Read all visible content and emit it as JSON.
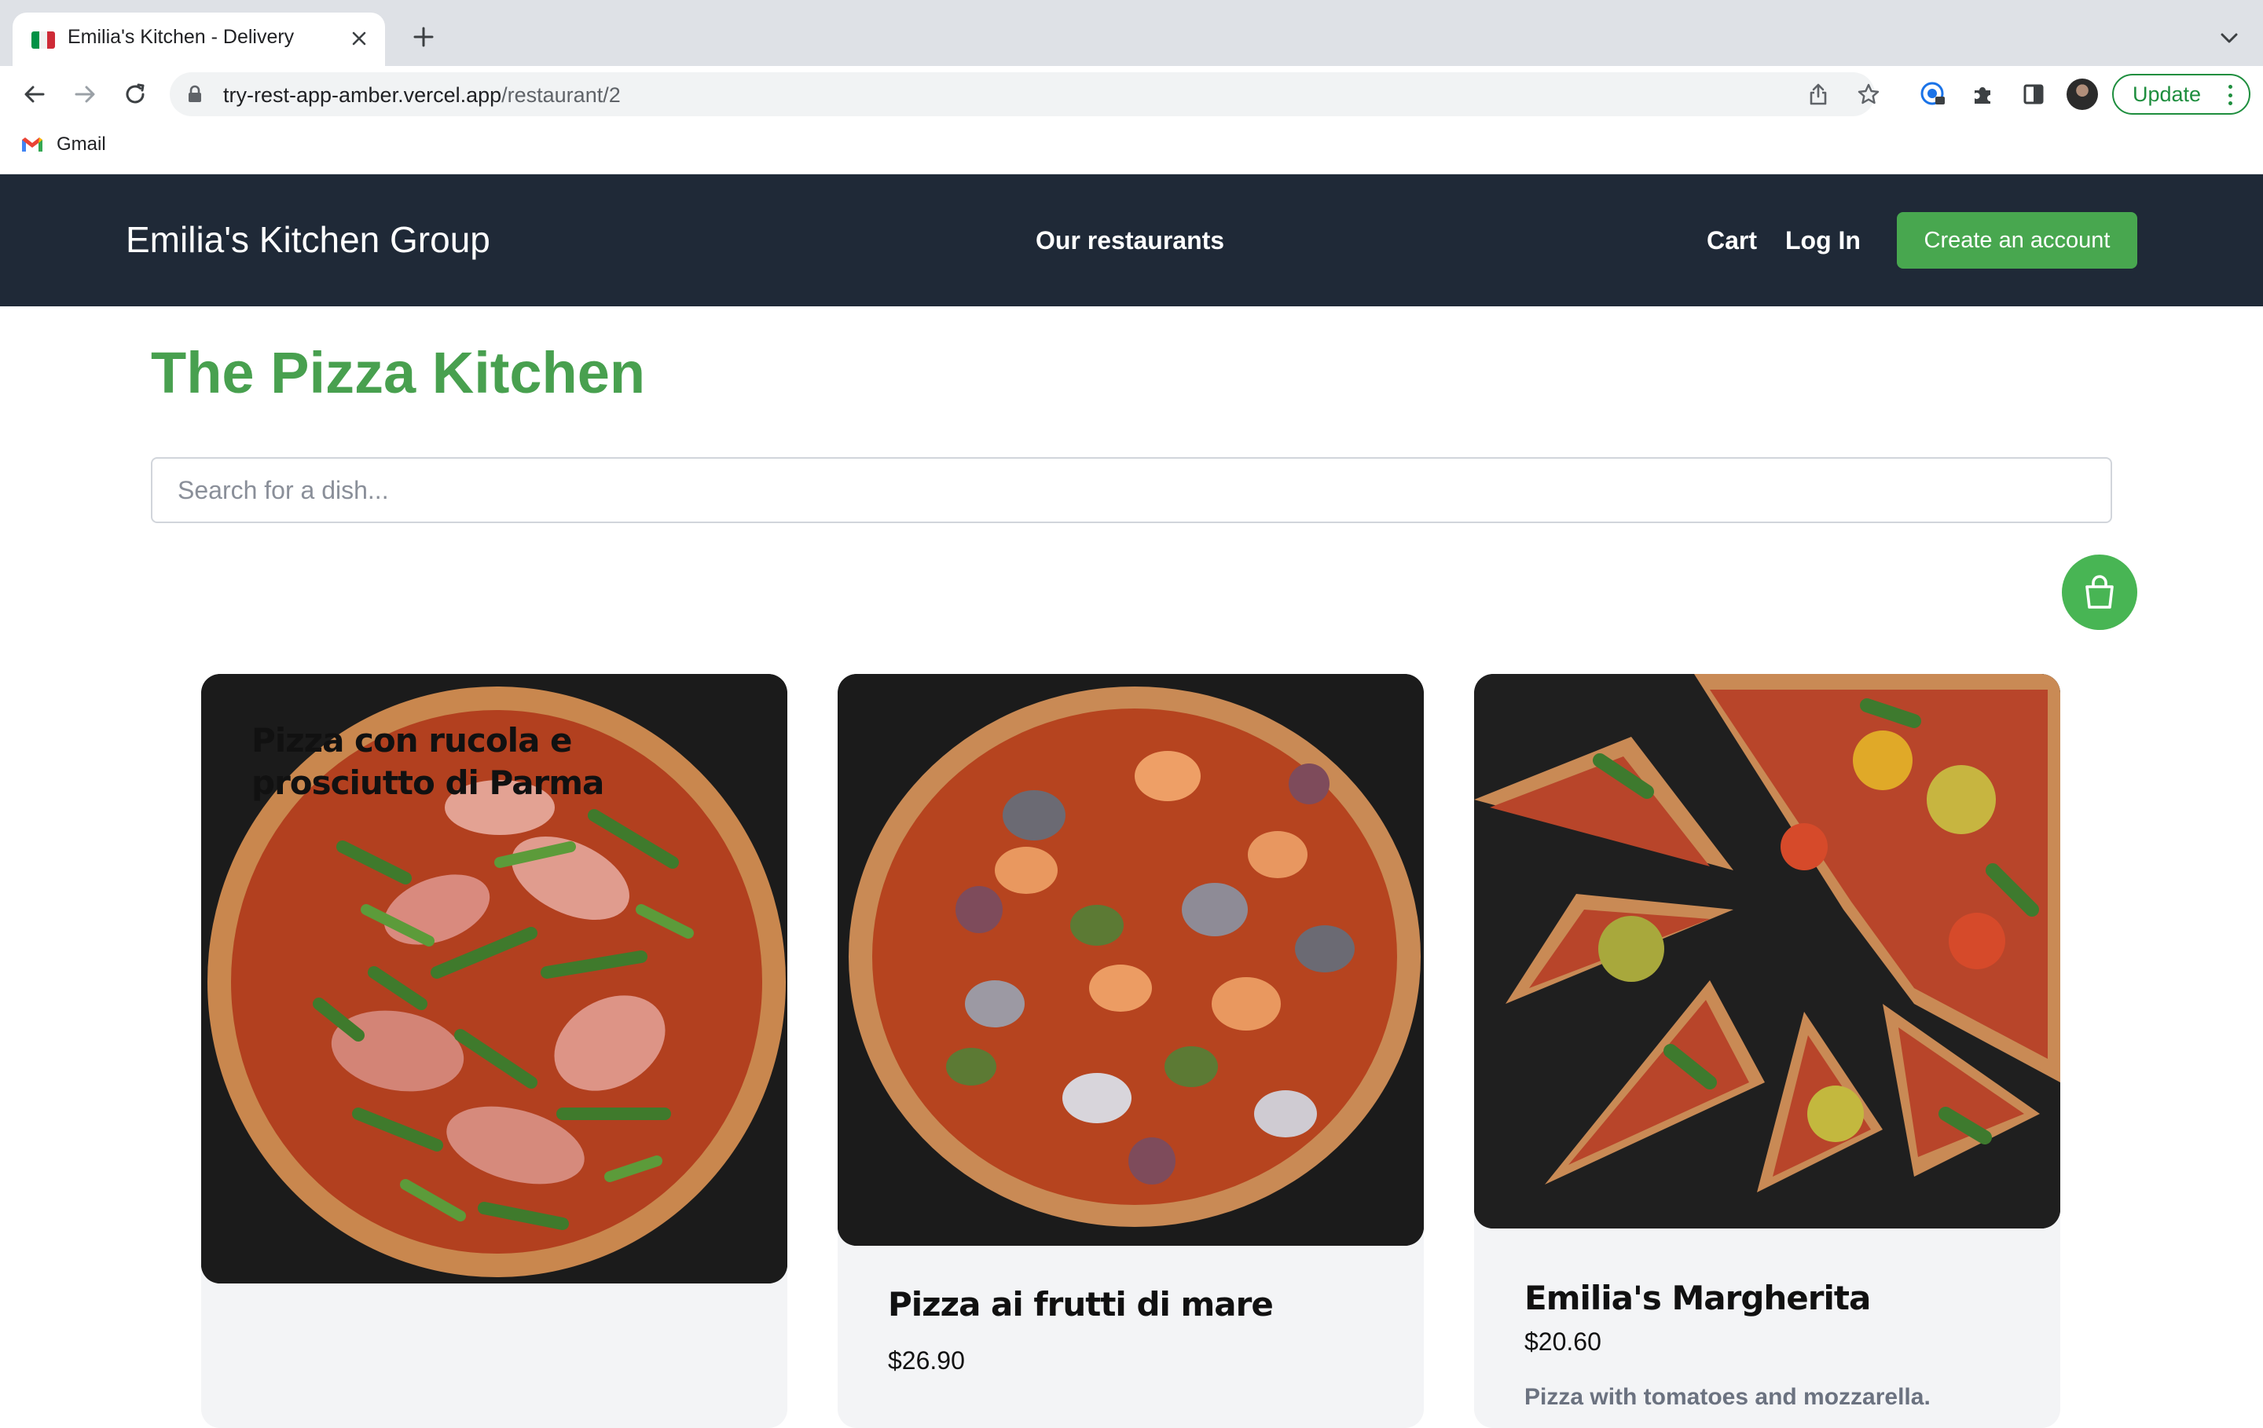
{
  "browser": {
    "tab_title": "Emilia's Kitchen - Delivery",
    "url_host": "try-rest-app-amber.vercel.app",
    "url_path": "/restaurant/2",
    "update_label": "Update",
    "bookmarks": [
      {
        "label": "Gmail",
        "icon": "gmail-icon"
      }
    ]
  },
  "header": {
    "brand": "Emilia's Kitchen Group",
    "nav_center": "Our restaurants",
    "cart": "Cart",
    "login": "Log In",
    "create_account": "Create an account",
    "bg_color": "#1f2937",
    "accent_color": "#48a74f"
  },
  "restaurant": {
    "title": "The Pizza Kitchen",
    "title_color": "#48a04f",
    "search_placeholder": "Search for a dish..."
  },
  "cart_button": {
    "icon": "shopping-bag-icon",
    "color": "#48b554"
  },
  "dishes": [
    {
      "name": "Pizza con rucola e prosciutto di Parma",
      "price": "",
      "description": "",
      "image": "pizza-prosciutto-arugula-photo"
    },
    {
      "name": "Pizza ai frutti di mare",
      "price": "$26.90",
      "description": "",
      "image": "pizza-seafood-photo"
    },
    {
      "name": "Emilia's Margherita",
      "price": "$20.60",
      "description": "Pizza with tomatoes and mozzarella.",
      "image": "pizza-margherita-sliced-photo"
    }
  ]
}
